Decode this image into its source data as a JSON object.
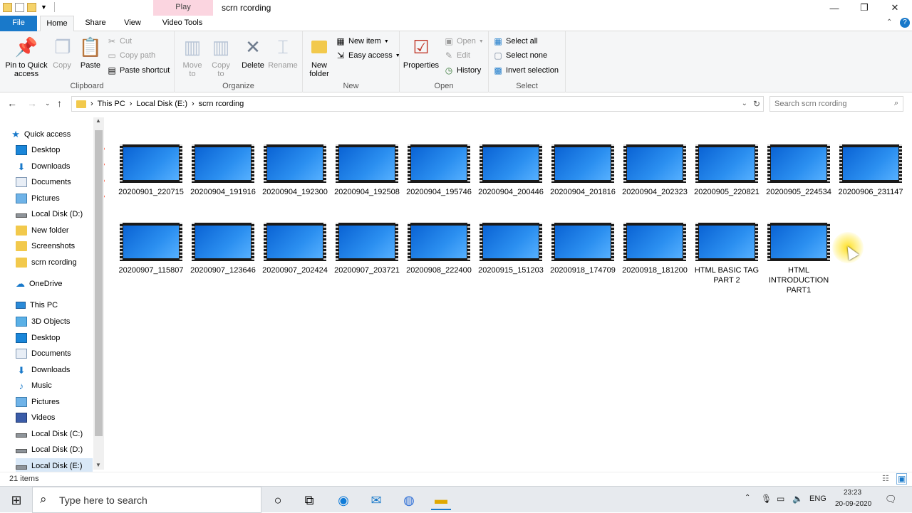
{
  "window": {
    "title": "scrn rcording",
    "context_tab": "Play",
    "minimize": "—",
    "maximize": "❐",
    "close": "✕"
  },
  "tabs": {
    "file": "File",
    "home": "Home",
    "share": "Share",
    "view": "View",
    "video_tools": "Video Tools"
  },
  "ribbon": {
    "clipboard": {
      "label": "Clipboard",
      "pin": "Pin to Quick access",
      "copy": "Copy",
      "paste": "Paste",
      "cut": "Cut",
      "copy_path": "Copy path",
      "paste_shortcut": "Paste shortcut"
    },
    "organize": {
      "label": "Organize",
      "move_to": "Move to",
      "copy_to": "Copy to",
      "delete": "Delete",
      "rename": "Rename"
    },
    "new": {
      "label": "New",
      "new_folder": "New folder",
      "new_item": "New item",
      "easy_access": "Easy access"
    },
    "open": {
      "label": "Open",
      "properties": "Properties",
      "open": "Open",
      "edit": "Edit",
      "history": "History"
    },
    "select": {
      "label": "Select",
      "select_all": "Select all",
      "select_none": "Select none",
      "invert": "Invert selection"
    }
  },
  "address": {
    "crumbs": [
      "This PC",
      "Local Disk (E:)",
      "scrn rcording"
    ],
    "search_placeholder": "Search scrn rcording"
  },
  "nav": {
    "quick_access": "Quick access",
    "quick_items": [
      {
        "label": "Desktop",
        "icon": "desktop-icon",
        "pinned": true
      },
      {
        "label": "Downloads",
        "icon": "download-icon",
        "pinned": true
      },
      {
        "label": "Documents",
        "icon": "documents-icon",
        "pinned": true
      },
      {
        "label": "Pictures",
        "icon": "pictures-icon",
        "pinned": true
      },
      {
        "label": "Local Disk (D:)",
        "icon": "drive-icon",
        "pinned": false
      },
      {
        "label": "New folder",
        "icon": "folder-icon",
        "pinned": false
      },
      {
        "label": "Screenshots",
        "icon": "folder-icon",
        "pinned": false
      },
      {
        "label": "scrn rcording",
        "icon": "folder-icon",
        "pinned": false
      }
    ],
    "onedrive": "OneDrive",
    "this_pc": "This PC",
    "pc_items": [
      {
        "label": "3D Objects",
        "icon": "cube-icon"
      },
      {
        "label": "Desktop",
        "icon": "desktop-icon"
      },
      {
        "label": "Documents",
        "icon": "documents-icon"
      },
      {
        "label": "Downloads",
        "icon": "download-icon"
      },
      {
        "label": "Music",
        "icon": "music-icon"
      },
      {
        "label": "Pictures",
        "icon": "pictures-icon"
      },
      {
        "label": "Videos",
        "icon": "video-icon"
      },
      {
        "label": "Local Disk (C:)",
        "icon": "drive-icon"
      },
      {
        "label": "Local Disk (D:)",
        "icon": "drive-icon"
      },
      {
        "label": "Local Disk (E:)",
        "icon": "drive-icon"
      }
    ]
  },
  "files": [
    "20200901_220715",
    "20200904_191916",
    "20200904_192300",
    "20200904_192508",
    "20200904_195746",
    "20200904_200446",
    "20200904_201816",
    "20200904_202323",
    "20200905_220821",
    "20200905_224534",
    "20200906_231147",
    "20200907_115807",
    "20200907_123646",
    "20200907_202424",
    "20200907_203721",
    "20200908_222400",
    "20200915_151203",
    "20200918_174709",
    "20200918_181200",
    "HTML BASIC TAG PART 2",
    "HTML INTRODUCTION PART1"
  ],
  "status": {
    "count": "21 items"
  },
  "taskbar": {
    "search_placeholder": "Type here to search",
    "lang": "ENG",
    "time": "23:23",
    "date": "20-09-2020"
  }
}
